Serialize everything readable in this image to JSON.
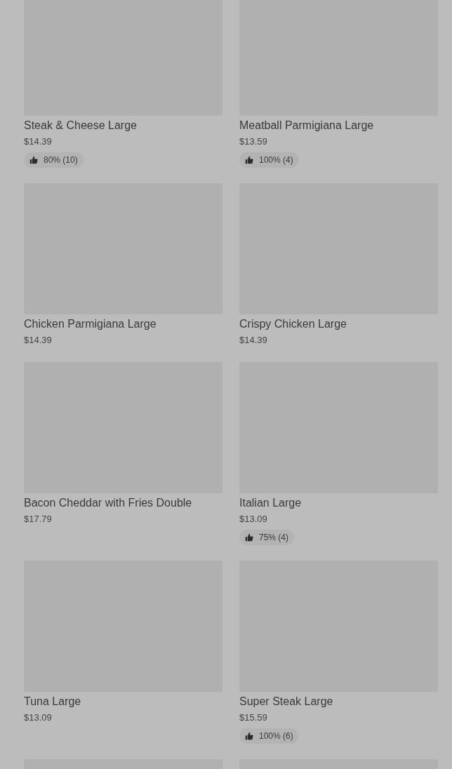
{
  "menu_items": [
    {
      "kind": "item",
      "name": "Steak & Cheese Large",
      "price": "$14.39",
      "rating": "80% (10)"
    },
    {
      "kind": "item",
      "name": "Meatball Parmigiana Large",
      "price": "$13.59",
      "rating": "100% (4)"
    },
    {
      "kind": "item",
      "name": "Chicken Parmigiana Large",
      "price": "$14.39"
    },
    {
      "kind": "item",
      "name": "Crispy Chicken Large",
      "price": "$14.39"
    },
    {
      "kind": "item",
      "name": "Bacon Cheddar with Fries Double",
      "price": "$17.79"
    },
    {
      "kind": "item",
      "name": "Italian Large",
      "price": "$13.09",
      "rating": "75% (4)"
    },
    {
      "kind": "item",
      "name": "Tuna Large",
      "price": "$13.09"
    },
    {
      "kind": "item",
      "name": "Super Steak Large",
      "price": "$15.59",
      "rating": "100% (6)"
    },
    {
      "kind": "image-only"
    },
    {
      "kind": "image-only"
    }
  ]
}
